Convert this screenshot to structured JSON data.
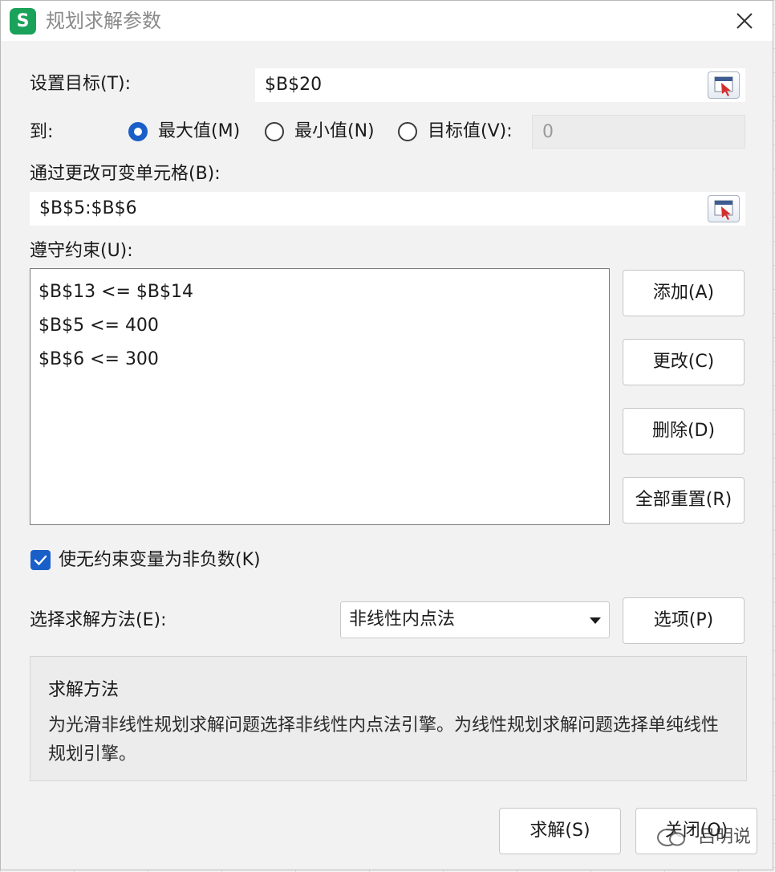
{
  "window": {
    "title": "规划求解参数",
    "app_icon_letter": "S",
    "close_glyph": "✕"
  },
  "objective": {
    "label": "设置目标(T):",
    "value": "$B$20"
  },
  "to": {
    "label": "到:",
    "options": [
      {
        "label": "最大值(M)",
        "selected": true
      },
      {
        "label": "最小值(N)",
        "selected": false
      },
      {
        "label": "目标值(V):",
        "selected": false
      }
    ],
    "target_value": "0"
  },
  "variables": {
    "label": "通过更改可变单元格(B):",
    "value": "$B$5:$B$6"
  },
  "constraints": {
    "label": "遵守约束(U):",
    "items": [
      "$B$13 <= $B$14",
      "$B$5 <= 400",
      "$B$6 <= 300"
    ],
    "buttons": {
      "add": "添加(A)",
      "change": "更改(C)",
      "delete": "删除(D)",
      "reset_all": "全部重置(R)"
    }
  },
  "nonneg": {
    "label": "使无约束变量为非负数(K)",
    "checked": true
  },
  "method": {
    "label": "选择求解方法(E):",
    "selected": "非线性内点法",
    "options_button": "选项(P)"
  },
  "method_info": {
    "title": "求解方法",
    "description": "为光滑非线性规划求解问题选择非线性内点法引擎。为线性规划求解问题选择单纯线性规划引擎。"
  },
  "footer": {
    "solve": "求解(S)",
    "close": "关闭(O)"
  },
  "watermark": {
    "text": "吕明说"
  },
  "colors": {
    "accent": "#1a5fc8",
    "app_icon": "#1aa25a"
  },
  "icons": {
    "app": "wps-s-icon",
    "close": "close-icon",
    "cell_reference": "cell-reference-icon",
    "dropdown": "chevron-down-icon",
    "checkmark": "check-icon"
  }
}
